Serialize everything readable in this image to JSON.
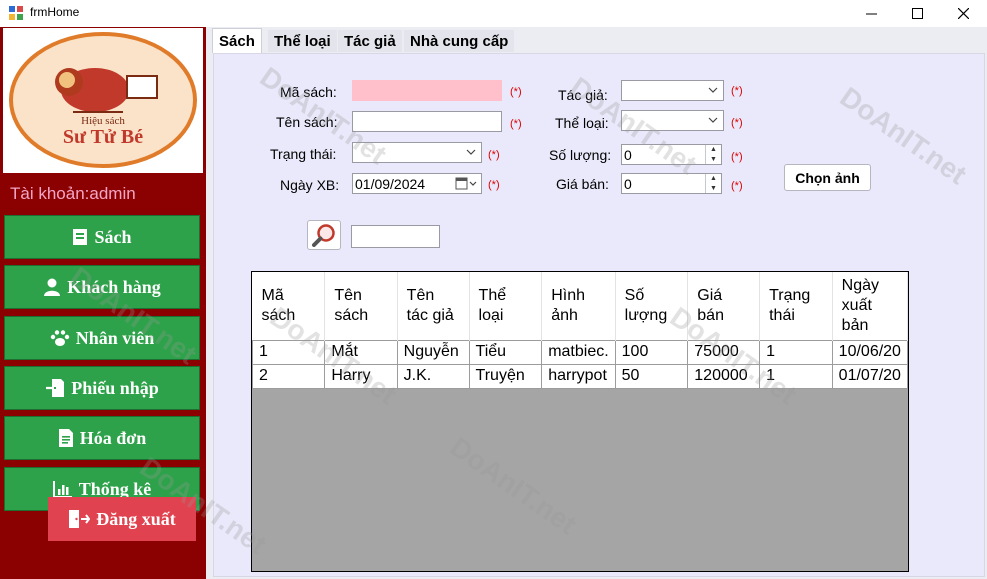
{
  "window": {
    "title": "frmHome"
  },
  "sidebar": {
    "logo_text_top": "Hiệu sách",
    "logo_text_main": "Sư Tử Bé",
    "account_label": "Tài khoản:admin",
    "items": [
      {
        "label": "Sách",
        "icon": "book-icon"
      },
      {
        "label": "Khách hàng",
        "icon": "user-icon"
      },
      {
        "label": "Nhân viên",
        "icon": "paw-icon"
      },
      {
        "label": "Phiếu nhập",
        "icon": "import-icon"
      },
      {
        "label": "Hóa đơn",
        "icon": "invoice-icon"
      },
      {
        "label": "Thống kê",
        "icon": "chart-icon"
      }
    ],
    "logout_label": "Đăng xuất"
  },
  "tabs": [
    {
      "label": "Sách",
      "active": true
    },
    {
      "label": "Thể loại",
      "active": false
    },
    {
      "label": "Tác giả",
      "active": false
    },
    {
      "label": "Nhà cung cấp",
      "active": false
    }
  ],
  "form": {
    "ma_sach_label": "Mã sách:",
    "ten_sach_label": "Tên sách:",
    "trang_thai_label": "Trạng thái:",
    "ngay_xb_label": "Ngày XB:",
    "ngay_xb_value": "01/09/2024",
    "tac_gia_label": "Tác giả:",
    "the_loai_label": "Thể loại:",
    "so_luong_label": "Số lượng:",
    "so_luong_value": "0",
    "gia_ban_label": "Giá bán:",
    "gia_ban_value": "0",
    "required_mark": "(*)",
    "choose_image_label": "Chọn ảnh"
  },
  "grid": {
    "columns": [
      "Mã sách",
      "Tên sách",
      "Tên tác giả",
      "Thể loại",
      "Hình ảnh",
      "Số lượng",
      "Giá bán",
      "Trạng thái",
      "Ngày xuất bản"
    ],
    "rows": [
      [
        "1",
        "Mắt",
        "Nguyễn",
        "Tiểu",
        "matbiec.",
        "100",
        "75000",
        "1",
        "10/06/20"
      ],
      [
        "2",
        "Harry",
        "J.K.",
        "Truyện",
        "harrypot",
        "50",
        "120000",
        "1",
        "01/07/20"
      ]
    ]
  },
  "watermark": "DoAnIT.net",
  "colors": {
    "sidebar_bg": "#8b0000",
    "button_green": "#2ea24a",
    "logout_red": "#e0434f",
    "required_red": "#e00000",
    "pink_field": "#ffc0cb"
  }
}
